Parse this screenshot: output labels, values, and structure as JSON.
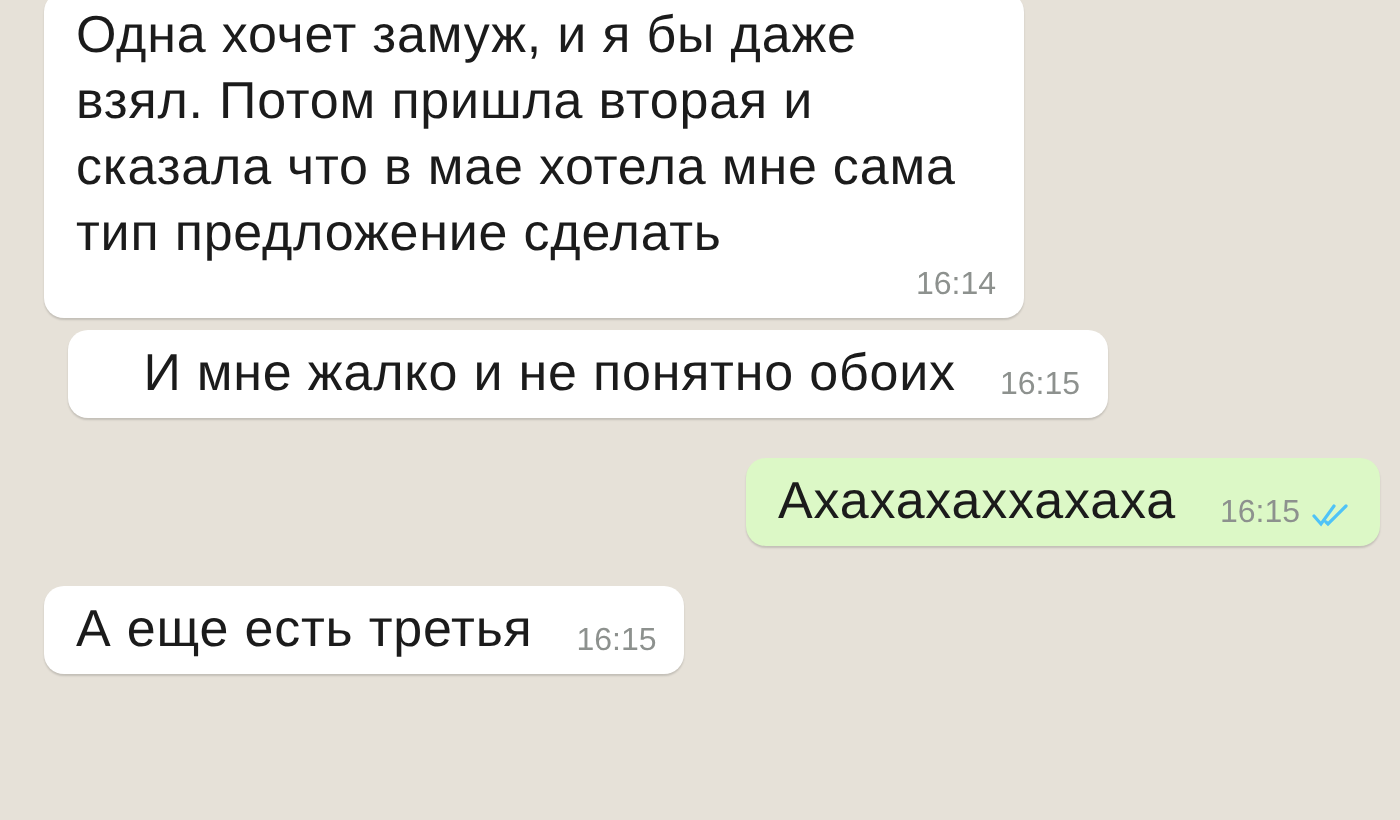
{
  "messages": [
    {
      "outgoing": false,
      "text": "Одна хочет замуж, и я бы даже взял. Потом пришла вторая и сказала что в мае хотела мне сама тип предложение сделать",
      "time": "16:14"
    },
    {
      "outgoing": false,
      "text": "И мне жалко и не понятно обоих",
      "time": "16:15"
    },
    {
      "outgoing": true,
      "text": "Ахахахаххахаха",
      "time": "16:15",
      "read": true
    },
    {
      "outgoing": false,
      "text": "А еще есть третья",
      "time": "16:15"
    }
  ]
}
